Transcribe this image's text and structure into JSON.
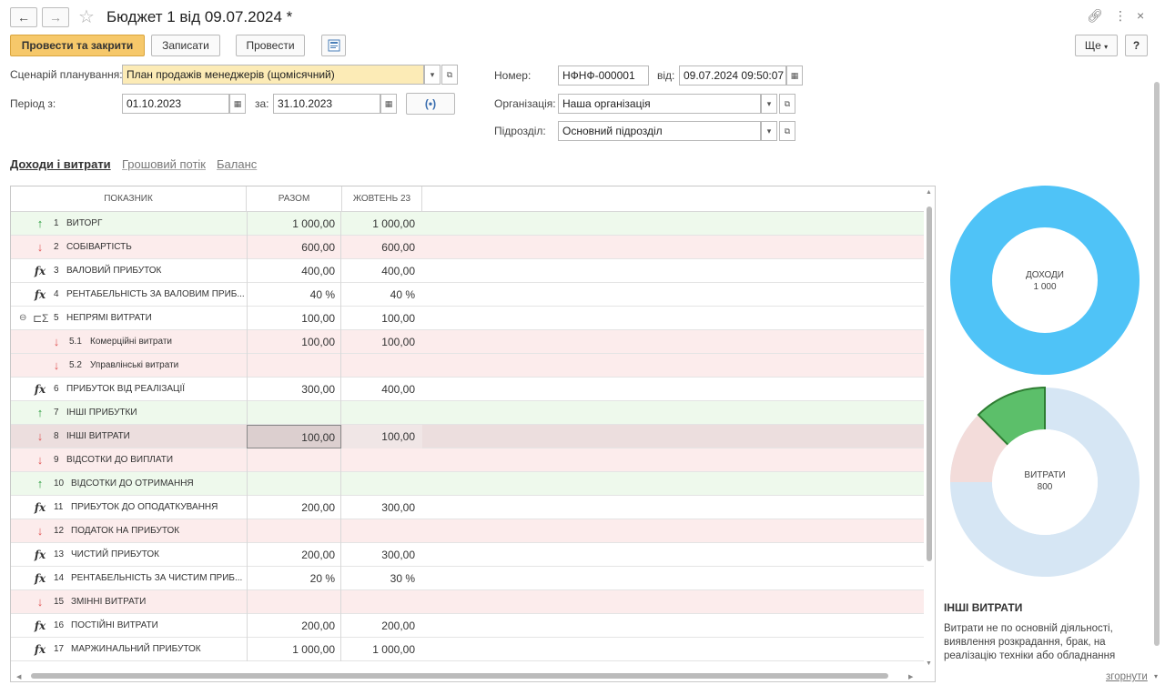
{
  "window": {
    "title": "Бюджет 1 від 09.07.2024 *"
  },
  "toolbar": {
    "post_close": "Провести та закрити",
    "save": "Записати",
    "post": "Провести",
    "more": "Ще",
    "help": "?"
  },
  "form": {
    "scenario_label": "Сценарій планування:",
    "scenario_value": "План продажів менеджерів (щомісячний)",
    "period_label": "Період з:",
    "period_from": "01.10.2023",
    "period_to_label": "за:",
    "period_to": "31.10.2023",
    "number_label": "Номер:",
    "number_value": "НФНФ-000001",
    "date_label": "від:",
    "date_value": "09.07.2024 09:50:07",
    "org_label": "Організація:",
    "org_value": "Наша організація",
    "dept_label": "Підрозділ:",
    "dept_value": "Основний підрозділ"
  },
  "tabs": [
    "Доходи і витрати",
    "Грошовий потік",
    "Баланс"
  ],
  "table": {
    "headers": [
      "ПОКАЗНИК",
      "РАЗОМ",
      "ЖОВТЕНЬ 23"
    ],
    "rows": [
      {
        "icon": "arrow-up",
        "num": "1",
        "name": "ВИТОРГ",
        "total": "1 000,00",
        "oct": "1 000,00"
      },
      {
        "icon": "arrow-down",
        "num": "2",
        "name": "СОБІВАРТІСТЬ",
        "total": "600,00",
        "oct": "600,00"
      },
      {
        "icon": "fx",
        "num": "3",
        "name": "ВАЛОВИЙ ПРИБУТОК",
        "total": "400,00",
        "oct": "400,00"
      },
      {
        "icon": "fx",
        "num": "4",
        "name": "РЕНТАБЕЛЬНІСТЬ ЗА ВАЛОВИМ ПРИБ...",
        "total": "40 %",
        "oct": "40 %"
      },
      {
        "icon": "group-sum",
        "num": "5",
        "name": "НЕПРЯМІ ВИТРАТИ",
        "total": "100,00",
        "oct": "100,00"
      },
      {
        "icon": "arrow-down",
        "num": "5.1",
        "name": "Комерційні витрати",
        "total": "100,00",
        "oct": "100,00"
      },
      {
        "icon": "arrow-down",
        "num": "5.2",
        "name": "Управлінські витрати",
        "total": "",
        "oct": ""
      },
      {
        "icon": "fx",
        "num": "6",
        "name": "ПРИБУТОК ВІД РЕАЛІЗАЦІЇ",
        "total": "300,00",
        "oct": "400,00"
      },
      {
        "icon": "arrow-up",
        "num": "7",
        "name": "ІНШІ ПРИБУТКИ",
        "total": "",
        "oct": ""
      },
      {
        "icon": "arrow-down",
        "num": "8",
        "name": "ІНШІ ВИТРАТИ",
        "total": "100,00",
        "oct": "100,00"
      },
      {
        "icon": "arrow-down",
        "num": "9",
        "name": "ВІДСОТКИ ДО ВИПЛАТИ",
        "total": "",
        "oct": ""
      },
      {
        "icon": "arrow-up",
        "num": "10",
        "name": "ВІДСОТКИ ДО ОТРИМАННЯ",
        "total": "",
        "oct": ""
      },
      {
        "icon": "fx",
        "num": "11",
        "name": "ПРИБУТОК ДО ОПОДАТКУВАННЯ",
        "total": "200,00",
        "oct": "300,00"
      },
      {
        "icon": "arrow-down",
        "num": "12",
        "name": "ПОДАТОК НА ПРИБУТОК",
        "total": "",
        "oct": ""
      },
      {
        "icon": "fx",
        "num": "13",
        "name": "ЧИСТИЙ ПРИБУТОК",
        "total": "200,00",
        "oct": "300,00"
      },
      {
        "icon": "fx",
        "num": "14",
        "name": "РЕНТАБЕЛЬНІСТЬ ЗА ЧИСТИМ ПРИБ...",
        "total": "20 %",
        "oct": "30 %"
      },
      {
        "icon": "arrow-down",
        "num": "15",
        "name": "ЗМІННІ ВИТРАТИ",
        "total": "",
        "oct": ""
      },
      {
        "icon": "fx",
        "num": "16",
        "name": "ПОСТІЙНІ ВИТРАТИ",
        "total": "200,00",
        "oct": "200,00"
      },
      {
        "icon": "fx",
        "num": "17",
        "name": "МАРЖИНАЛЬНИЙ ПРИБУТОК",
        "total": "1 000,00",
        "oct": "1 000,00"
      }
    ]
  },
  "side": {
    "income_label": "ДОХОДИ",
    "income_value": "1 000",
    "expense_label": "ВИТРАТИ",
    "expense_value": "800",
    "selected_title": "ІНШІ ВИТРАТИ",
    "selected_desc": "Витрати не по основній діяльності, виявлення розкрадання, брак, на реалізацію техніки або обладнання",
    "collapse": "згорнути",
    "colors": {
      "income": "#4fc3f7",
      "expense_light": "#d6e6f4",
      "expense_pink": "#f3dcda",
      "selected": "#5cbf6a"
    }
  }
}
